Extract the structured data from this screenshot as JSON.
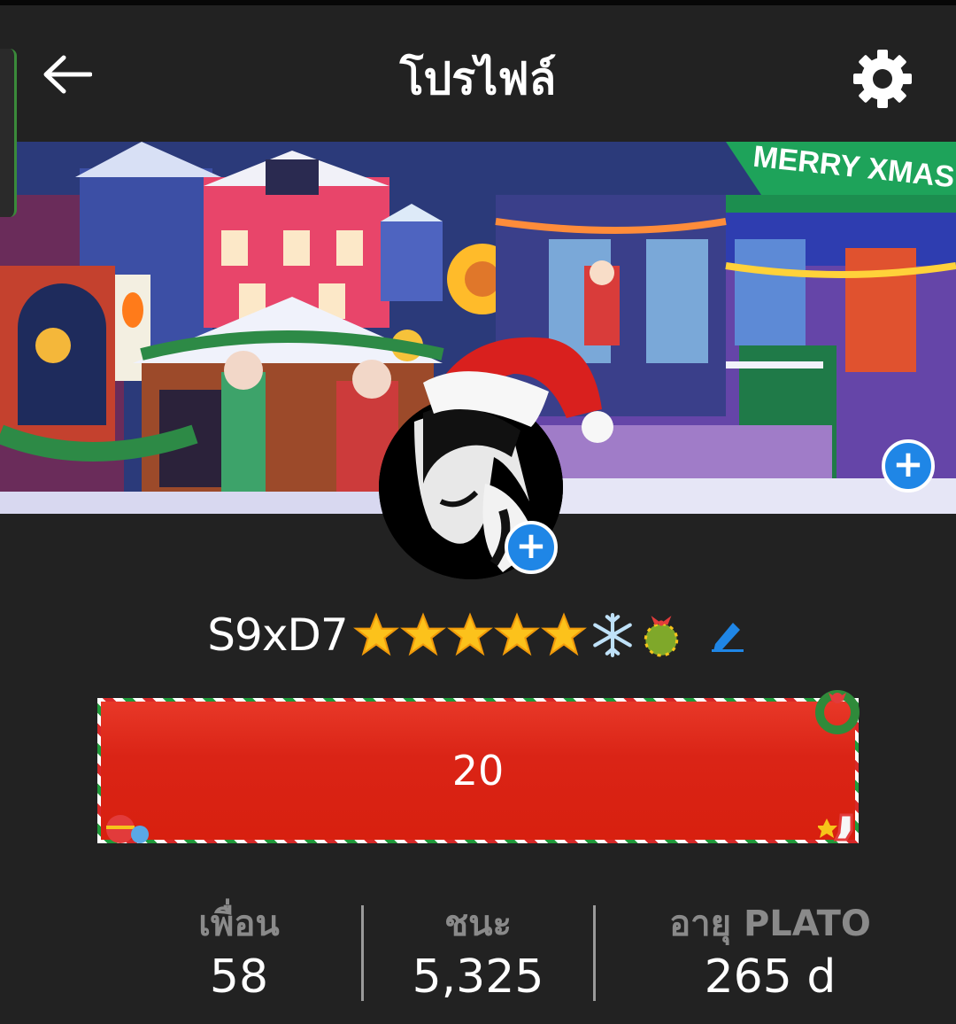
{
  "header": {
    "title": "โปรไฟล์",
    "back_icon": "arrow-left-icon",
    "settings_icon": "gear-icon"
  },
  "banner": {
    "sign_text": "MERRY XMAS",
    "add_icon": "plus-icon"
  },
  "profile": {
    "username": "S9xD7",
    "badges": [
      "star-icon",
      "star-icon",
      "star-icon",
      "star-icon",
      "star-icon",
      "snowflake-icon",
      "christmas-ornament-icon"
    ],
    "edit_icon": "pencil-icon"
  },
  "level": {
    "value": "20"
  },
  "stats": [
    {
      "label": "เพื่อน",
      "value": "58"
    },
    {
      "label": "ชนะ",
      "value": "5,325"
    },
    {
      "label": "อายุ PLATO",
      "value": "265 d"
    }
  ],
  "colors": {
    "background": "#222222",
    "accent_blue": "#1f86e6",
    "level_red": "#da2416",
    "stat_label": "#8a8a8a"
  }
}
